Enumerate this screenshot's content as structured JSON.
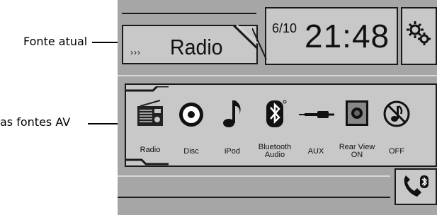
{
  "callouts": {
    "current_source": "Fonte atual",
    "av_sources": "as fontes AV"
  },
  "source_panel": {
    "arrows": "›››",
    "label": "Radio"
  },
  "clock": {
    "date": "6/10",
    "time": "21:48"
  },
  "av_sources": [
    {
      "label": "Radio",
      "icon": "radio-icon"
    },
    {
      "label": "Disc",
      "icon": "disc-icon"
    },
    {
      "label": "iPod",
      "icon": "music-note-icon"
    },
    {
      "label": "Bluetooth Audio",
      "label_line1": "Bluetooth",
      "label_line2": "Audio",
      "icon": "bluetooth-icon"
    },
    {
      "label": "AUX",
      "icon": "aux-cable-icon"
    },
    {
      "label": "Rear View ON",
      "label_line1": "Rear View",
      "label_line2": "ON",
      "icon": "rear-camera-icon"
    },
    {
      "label": "OFF",
      "icon": "off-icon"
    }
  ],
  "icons": {
    "settings": "gears-icon",
    "phone": "bluetooth-phone-icon"
  },
  "colors": {
    "screen_bg": "#a6a6a6",
    "panel_bg": "#c8c8c8",
    "border": "#1a1a1a"
  }
}
